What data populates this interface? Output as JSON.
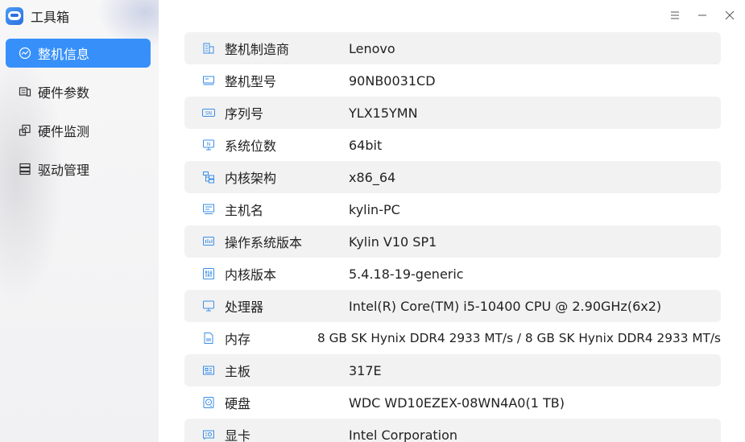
{
  "app": {
    "title": "工具箱"
  },
  "sidebar": {
    "items": [
      {
        "label": "整机信息",
        "icon": "info-icon",
        "active": true
      },
      {
        "label": "硬件参数",
        "icon": "hardware-icon",
        "active": false
      },
      {
        "label": "硬件监测",
        "icon": "monitor-icon",
        "active": false
      },
      {
        "label": "驱动管理",
        "icon": "driver-icon",
        "active": false
      }
    ]
  },
  "window": {
    "menu": "menu-icon",
    "minimize": "minimize-icon",
    "close": "close-icon"
  },
  "info": {
    "rows": [
      {
        "label": "整机制造商",
        "value": "Lenovo",
        "icon": "building-icon"
      },
      {
        "label": "整机型号",
        "value": "90NB0031CD",
        "icon": "model-icon"
      },
      {
        "label": "序列号",
        "value": "YLX15YMN",
        "icon": "serial-icon"
      },
      {
        "label": "系统位数",
        "value": "64bit",
        "icon": "system-bits-icon"
      },
      {
        "label": "内核架构",
        "value": "x86_64",
        "icon": "architecture-icon"
      },
      {
        "label": "主机名",
        "value": "kylin-PC",
        "icon": "hostname-icon"
      },
      {
        "label": "操作系统版本",
        "value": "Kylin V10 SP1",
        "icon": "os-version-icon"
      },
      {
        "label": "内核版本",
        "value": "5.4.18-19-generic",
        "icon": "kernel-version-icon"
      },
      {
        "label": "处理器",
        "value": "Intel(R) Core(TM) i5-10400 CPU @ 2.90GHz(6x2)",
        "icon": "processor-icon"
      },
      {
        "label": "内存",
        "value": "8 GB SK Hynix DDR4 2933 MT/s / 8 GB SK Hynix DDR4 2933 MT/s",
        "icon": "memory-icon"
      },
      {
        "label": "主板",
        "value": "317E",
        "icon": "motherboard-icon"
      },
      {
        "label": "硬盘",
        "value": "WDC WD10EZEX-08WN4A0(1 TB)",
        "icon": "harddisk-icon"
      },
      {
        "label": "显卡",
        "value": "Intel Corporation",
        "icon": "graphics-card-icon"
      }
    ]
  },
  "colors": {
    "accent": "#3790fa",
    "row_alt": "#f2f2f3",
    "icon": "#3a8ee6"
  }
}
